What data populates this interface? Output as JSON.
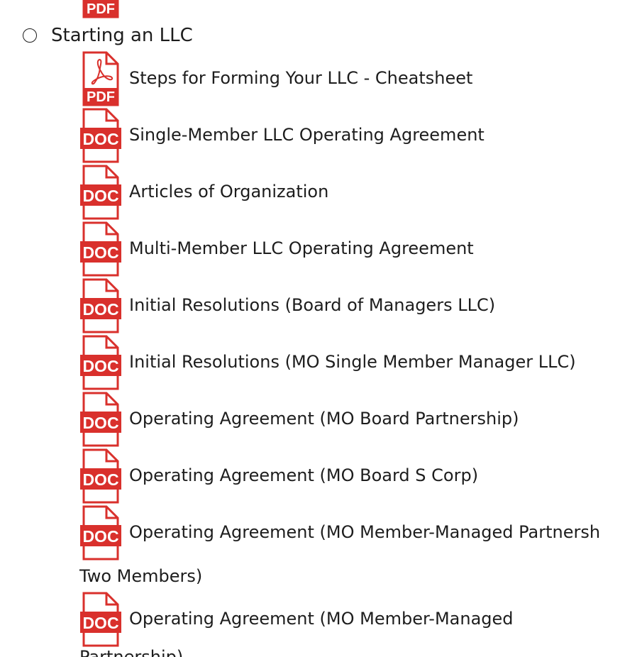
{
  "icon_colors": {
    "accent": "#d9302c",
    "paper": "#ffffff"
  },
  "icon_labels": {
    "pdf": "PDF",
    "doc": "DOC"
  },
  "section": {
    "title": "Starting an LLC"
  },
  "files": [
    {
      "type": "pdf",
      "icon": "pdf-file-icon",
      "title": "Steps for Forming Your LLC - Cheatsheet"
    },
    {
      "type": "doc",
      "icon": "doc-file-icon",
      "title": "Single-Member LLC Operating Agreement"
    },
    {
      "type": "doc",
      "icon": "doc-file-icon",
      "title": "Articles of Organization"
    },
    {
      "type": "doc",
      "icon": "doc-file-icon",
      "title": "Multi-Member LLC Operating Agreement"
    },
    {
      "type": "doc",
      "icon": "doc-file-icon",
      "title": "Initial Resolutions (Board of Managers LLC)"
    },
    {
      "type": "doc",
      "icon": "doc-file-icon",
      "title": "Initial Resolutions (MO Single Member Manager LLC)"
    },
    {
      "type": "doc",
      "icon": "doc-file-icon",
      "title": "Operating Agreement (MO Board Partnership)"
    },
    {
      "type": "doc",
      "icon": "doc-file-icon",
      "title": "Operating Agreement (MO Board S Corp)"
    },
    {
      "type": "doc",
      "icon": "doc-file-icon",
      "title": "Operating Agreement (MO Member-Managed Partnersh",
      "continuation": "Two Members)"
    },
    {
      "type": "doc",
      "icon": "doc-file-icon",
      "title": "Operating Agreement (MO Member-Managed",
      "continuation": "Partnership)"
    }
  ]
}
